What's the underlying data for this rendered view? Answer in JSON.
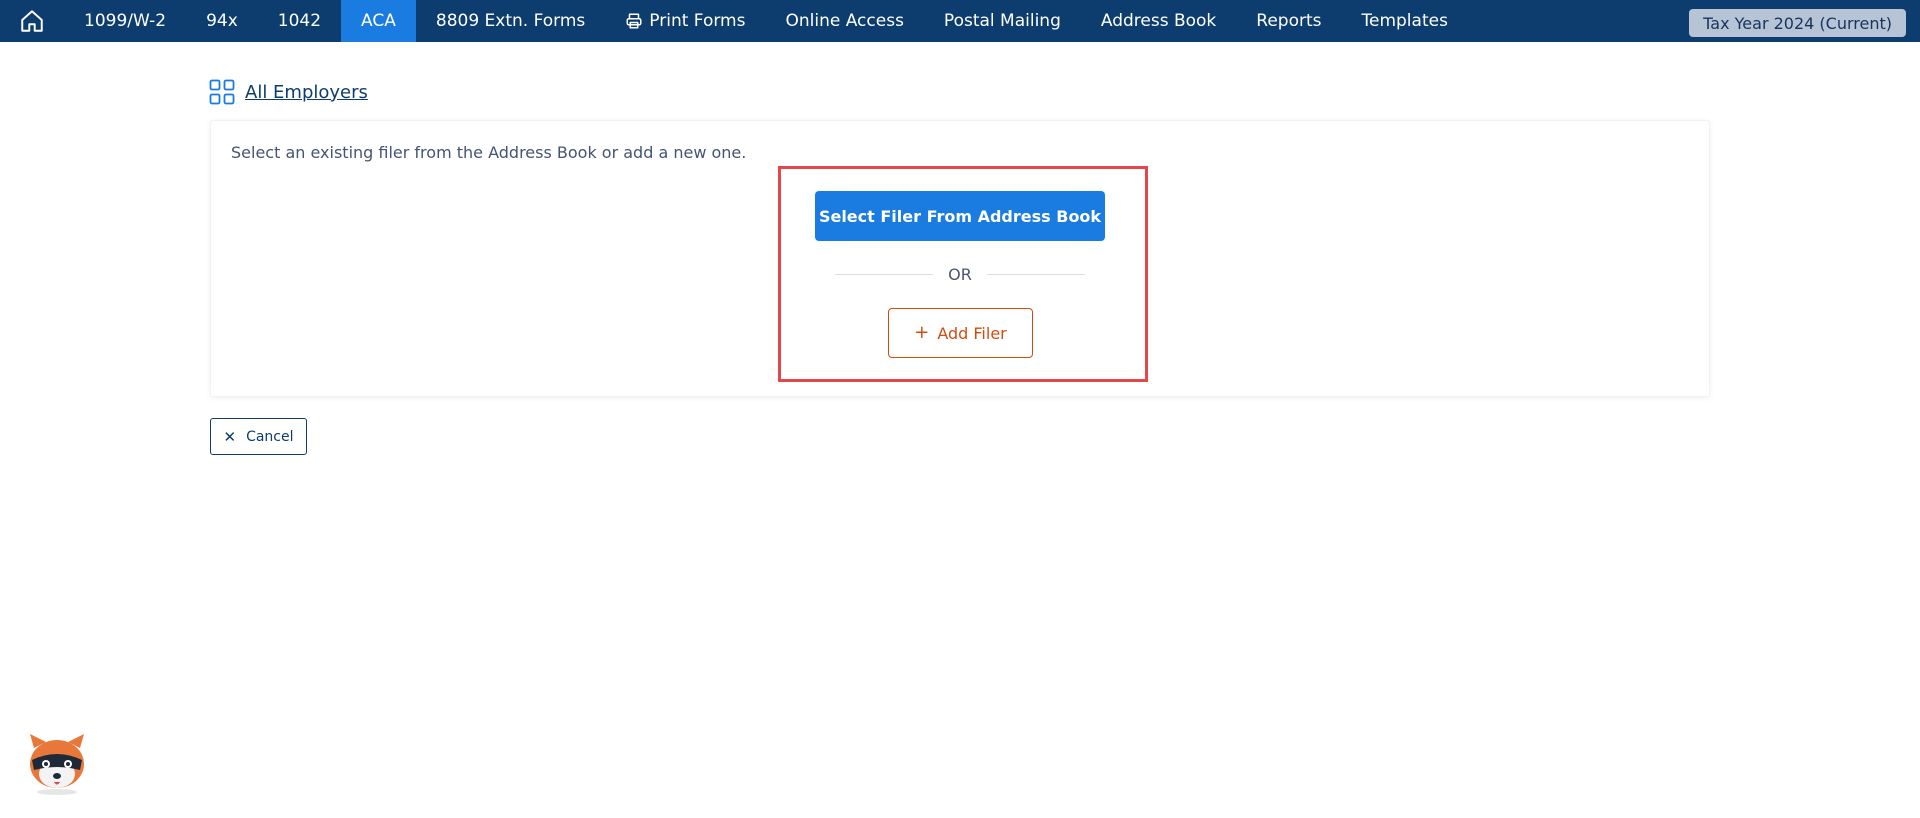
{
  "nav": {
    "items": [
      {
        "label": "1099/W-2"
      },
      {
        "label": "94x"
      },
      {
        "label": "1042"
      },
      {
        "label": "ACA"
      },
      {
        "label": "8809 Extn. Forms"
      },
      {
        "label": "Print Forms",
        "icon": "printer-icon"
      },
      {
        "label": "Online Access"
      },
      {
        "label": "Postal Mailing"
      },
      {
        "label": "Address Book"
      },
      {
        "label": "Reports"
      },
      {
        "label": "Templates"
      }
    ],
    "active": "ACA",
    "home_icon": "home-icon",
    "tax_year": "Tax Year 2024 (Current)"
  },
  "breadcrumb": {
    "link": "All Employers",
    "icon": "grid-icon"
  },
  "card": {
    "intro": "Select an existing filer from the Address Book or add a new one.",
    "select_button": "Select Filer From Address Book",
    "or_text": "OR",
    "add_button": "Add Filer"
  },
  "footer": {
    "cancel_button": "Cancel"
  },
  "colors": {
    "nav_bg": "#0d3d6e",
    "active": "#1a7be0",
    "primary": "#1a7be0",
    "add": "#d24c0f",
    "highlight": "#e3474a"
  },
  "mascot_icon": "raccoon-mascot-icon"
}
